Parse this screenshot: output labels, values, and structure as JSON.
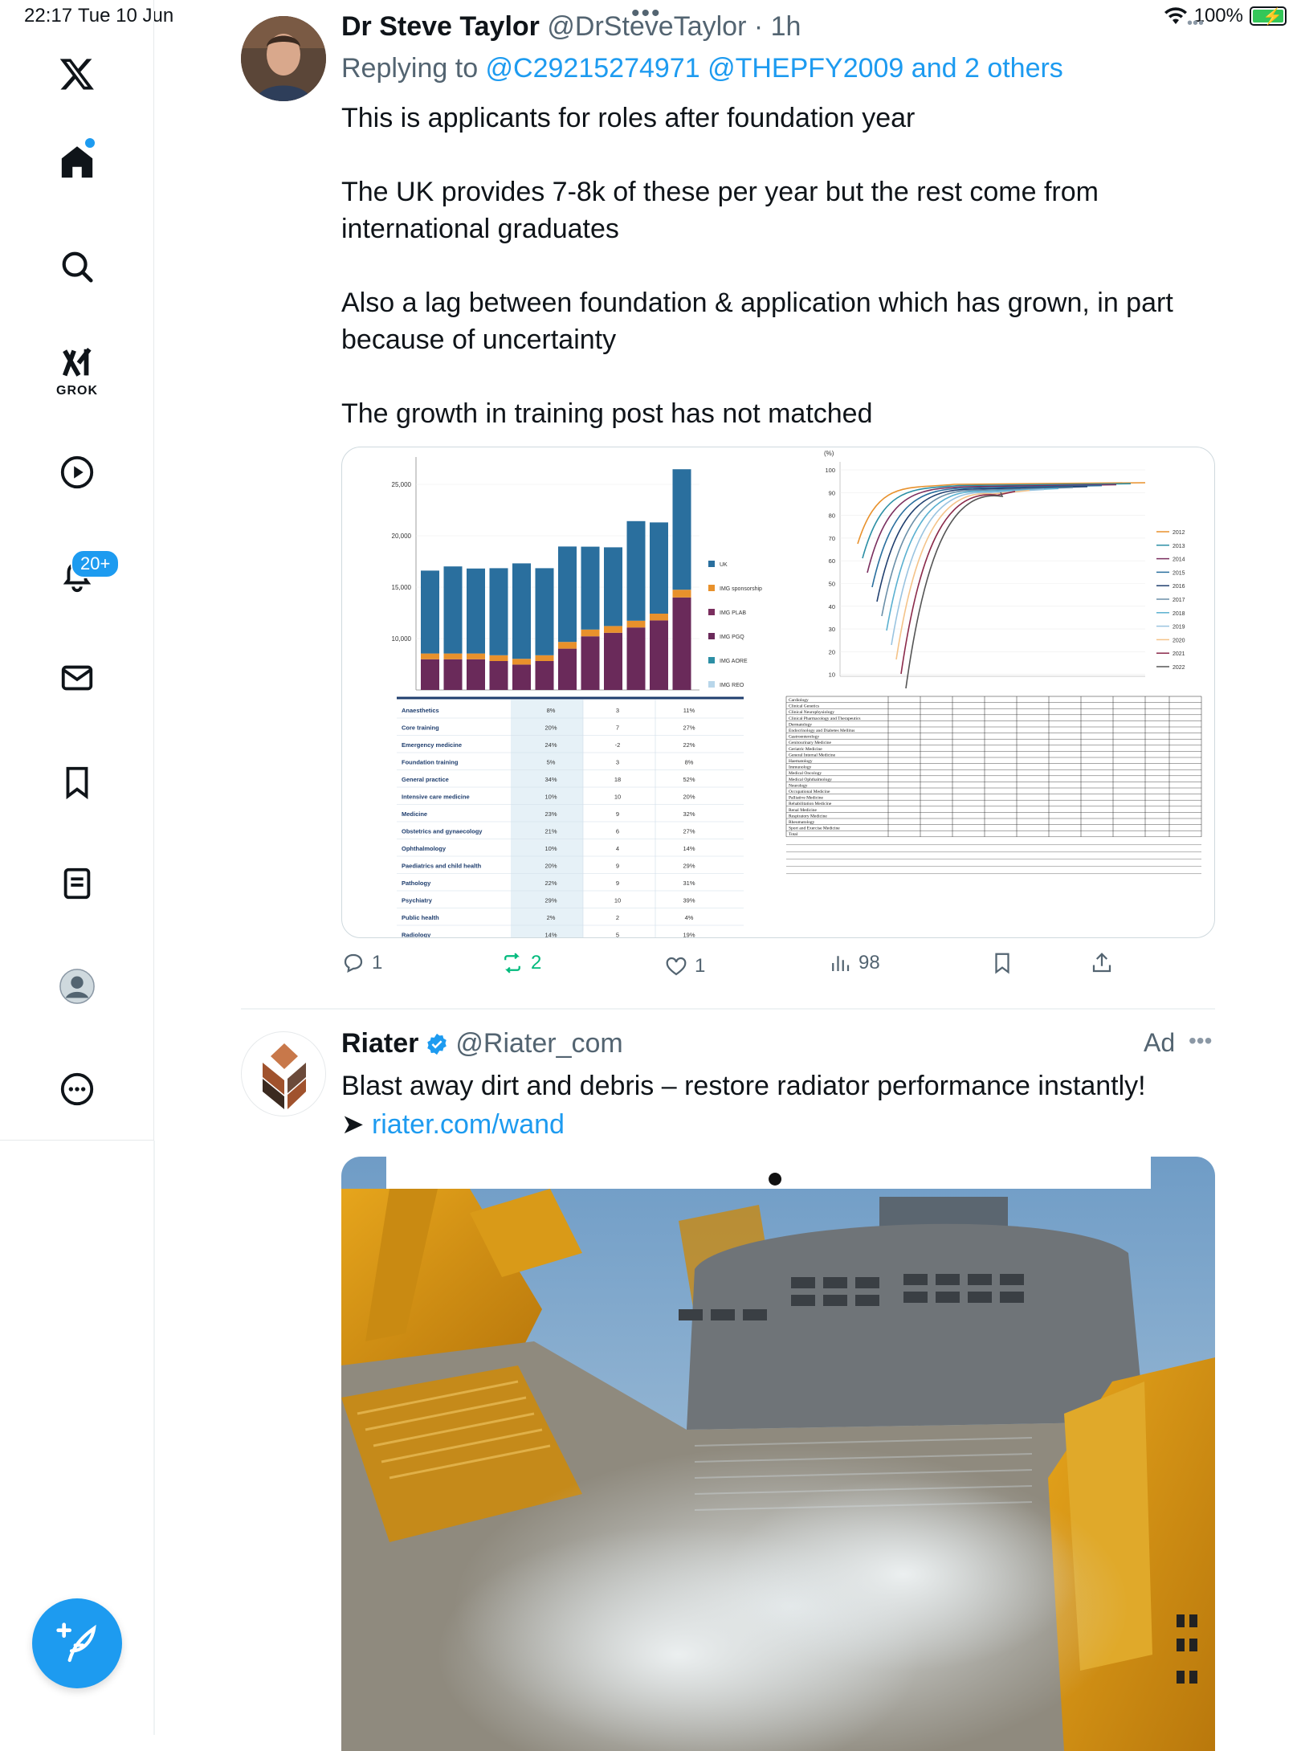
{
  "status_bar": {
    "time": "22:17",
    "date": "Tue 10 Jun",
    "battery": "100%"
  },
  "sidebar": {
    "items": [
      {
        "name": "x-logo"
      },
      {
        "name": "home",
        "label": "Home"
      },
      {
        "name": "search",
        "label": "Search"
      },
      {
        "name": "grok",
        "label": "GROK"
      },
      {
        "name": "videos"
      },
      {
        "name": "notifications",
        "badge": "20+"
      },
      {
        "name": "messages"
      },
      {
        "name": "bookmarks"
      },
      {
        "name": "lists"
      },
      {
        "name": "profile"
      },
      {
        "name": "more"
      }
    ]
  },
  "tweet": {
    "author_name": "Dr Steve Taylor",
    "author_handle": "@DrSteveTaylor",
    "time": "· 1h",
    "replying_prefix": "Replying to ",
    "replying_to": "@C29215274971 @THEPFY2009 and 2 others",
    "paragraphs": [
      "This is applicants for roles after foundation year",
      "The UK provides 7-8k of these per year but the rest come from international graduates",
      "Also a lag between foundation & application which has grown, in part because of uncertainty",
      "The growth in training post has not matched"
    ],
    "bar_chart": {
      "yticks": [
        "25,000",
        "20,000",
        "15,000",
        "10,000"
      ],
      "legend": [
        "UK",
        "IMG sponsorship",
        "IMG PLAB",
        "IMG PGQ",
        "IMG AORE",
        "IMG REO"
      ],
      "colors": {
        "uk": "#2a6f9e",
        "sponsorship": "#e8912c",
        "plab": "#7a2e5e",
        "pgq": "#6a2a5a",
        "aore": "#2c8fa5",
        "reo": "#b8d6ea"
      }
    },
    "table_left": {
      "rows": [
        [
          "Anaesthetics",
          "8%",
          "3",
          "11%"
        ],
        [
          "Core training",
          "20%",
          "7",
          "27%"
        ],
        [
          "Emergency medicine",
          "24%",
          "-2",
          "22%"
        ],
        [
          "Foundation training",
          "5%",
          "3",
          "8%"
        ],
        [
          "General practice",
          "34%",
          "18",
          "52%"
        ],
        [
          "Intensive care medicine",
          "10%",
          "10",
          "20%"
        ],
        [
          "Medicine",
          "23%",
          "9",
          "32%"
        ],
        [
          "Obstetrics and gynaecology",
          "21%",
          "6",
          "27%"
        ],
        [
          "Ophthalmology",
          "10%",
          "4",
          "14%"
        ],
        [
          "Paediatrics and child health",
          "20%",
          "9",
          "29%"
        ],
        [
          "Pathology",
          "22%",
          "9",
          "31%"
        ],
        [
          "Psychiatry",
          "29%",
          "10",
          "39%"
        ],
        [
          "Public health",
          "2%",
          "2",
          "4%"
        ],
        [
          "Radiology",
          "14%",
          "5",
          "19%"
        ]
      ]
    },
    "line_chart": {
      "ylabel": "(%)",
      "yticks": [
        "100",
        "90",
        "80",
        "70",
        "60",
        "50",
        "40",
        "30",
        "20",
        "10"
      ],
      "legend": [
        "2012",
        "2013",
        "2014",
        "2015",
        "2016",
        "2017",
        "2018",
        "2019",
        "2020",
        "2021",
        "2022"
      ]
    },
    "table_right": {
      "rows": [
        "Cardiology",
        "Clinical Genetics",
        "Clinical Neurophysiology",
        "Clinical Pharmacology and Therapeutics",
        "Dermatology",
        "Endocrinology and Diabetes Mellitus",
        "Gastroenterology",
        "Genitourinary Medicine",
        "Geriatric Medicine",
        "General Internal Medicine",
        "Haematology",
        "Immunology",
        "Medical Oncology",
        "Medical Ophthalmology",
        "Neurology",
        "Occupational Medicine",
        "Palliative Medicine",
        "Rehabilitation Medicine",
        "Renal Medicine",
        "Respiratory Medicine",
        "Rheumatology",
        "Sport and Exercise Medicine",
        "Total"
      ]
    },
    "actions": {
      "replies": "1",
      "reposts": "2",
      "likes": "1",
      "views": "98"
    }
  },
  "ad": {
    "name": "Riater",
    "handle": "@Riater_com",
    "tag": "Ad",
    "text": "Blast away dirt and debris – restore radiator performance instantly!",
    "link_prefix": "➤ ",
    "link": "riater.com/wand"
  }
}
